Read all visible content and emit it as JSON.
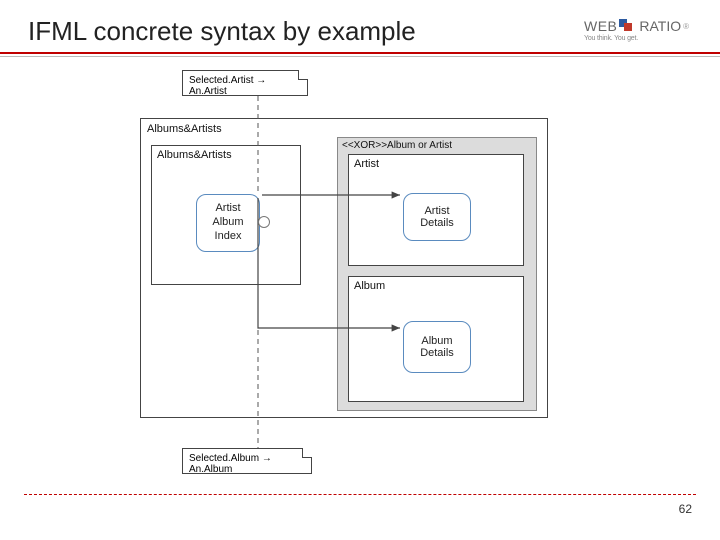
{
  "title": "IFML concrete syntax by example",
  "logo": {
    "web": "WEB",
    "ratio": "RATIO",
    "reg": "®",
    "tagline": "You think. You get."
  },
  "notes": {
    "top": "Selected.Artist → An.Artist",
    "bottom": "Selected.Album → An.Album"
  },
  "diagram": {
    "outer_label": "Albums&Artists",
    "left_view_label": "Albums&Artists",
    "index_lines": {
      "l1": "Artist",
      "l2": "Album",
      "l3": "Index"
    },
    "xor_label": "<<XOR>>Album or Artist",
    "artist_view_label": "Artist",
    "album_view_label": "Album",
    "artist_details": {
      "l1": "Artist",
      "l2": "Details"
    },
    "album_details": {
      "l1": "Album",
      "l2": "Details"
    }
  },
  "page_number": "62"
}
